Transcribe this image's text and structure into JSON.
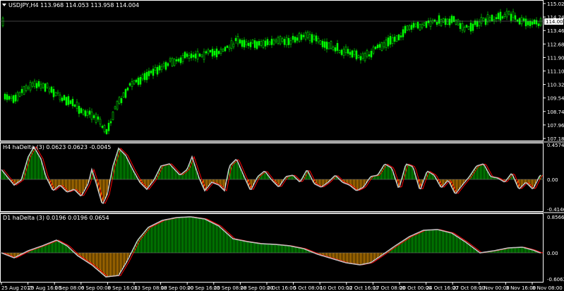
{
  "main_chart": {
    "title": "USDJPY,H4  113.968 114.053 113.958 114.004",
    "price_ticks": [
      "115.020",
      "114.240",
      "113.460",
      "112.680",
      "111.900",
      "111.100",
      "110.320",
      "109.540",
      "108.740",
      "107.960",
      "107.180"
    ],
    "current_price": "114.004",
    "candle_color": "#00ff00",
    "grid_color": "#ffffff"
  },
  "indicator1": {
    "title": "H4 haDelta (3) 0.0623 0.0623 -0.0045",
    "ticks": [
      "0.4574",
      "0.00",
      "-0.4146"
    ],
    "current_value": "0.00"
  },
  "indicator2": {
    "title": "D1 haDelta (3) 0.0196 0.0196 0.0654",
    "ticks": [
      "0.8566",
      "0.00",
      "-0.6062"
    ],
    "current_value": "0.00"
  },
  "colors": {
    "positive": "#00c000",
    "negative": "#ffa500",
    "signal": "#ff0000",
    "smooth": "#c0c0c0"
  },
  "time_axis": [
    "25 Aug 2017",
    "29 Aug 16:00",
    "1 Sep 08:00",
    "6 Sep 00:00",
    "8 Sep 16:00",
    "13 Sep 08:00",
    "18 Sep 00:00",
    "20 Sep 16:00",
    "25 Sep 08:00",
    "28 Sep 00:00",
    "2 Oct 16:00",
    "5 Oct 08:00",
    "10 Oct 00:00",
    "12 Oct 16:00",
    "17 Oct 08:00",
    "20 Oct 00:00",
    "24 Oct 16:00",
    "27 Oct 08:00",
    "1 Nov 00:00",
    "3 Nov 16:00",
    "8 Nov 08:00"
  ]
}
